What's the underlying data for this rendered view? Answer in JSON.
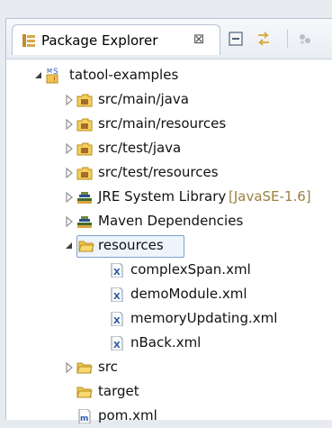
{
  "view": {
    "title": "Package Explorer",
    "close_glyph": "⊠",
    "toolbar_icons": [
      "collapse-all-icon",
      "link-with-editor-icon",
      "view-menu-icon"
    ]
  },
  "tree": {
    "project": {
      "label": "tatool-examples",
      "expanded": true,
      "icon": "maven-project-icon"
    },
    "items": [
      {
        "label": "src/main/java",
        "icon": "source-folder-icon",
        "expanded": false
      },
      {
        "label": "src/main/resources",
        "icon": "source-folder-icon",
        "expanded": false
      },
      {
        "label": "src/test/java",
        "icon": "source-folder-icon",
        "expanded": false
      },
      {
        "label": "src/test/resources",
        "icon": "source-folder-icon",
        "expanded": false
      },
      {
        "label": "JRE System Library",
        "decoration": "[JavaSE-1.6]",
        "icon": "library-icon",
        "expanded": false
      },
      {
        "label": "Maven Dependencies",
        "icon": "library-icon",
        "expanded": false
      },
      {
        "label": "resources",
        "icon": "folder-icon",
        "expanded": true,
        "selected": true
      },
      {
        "label": "complexSpan.xml",
        "icon": "xml-file-icon"
      },
      {
        "label": "demoModule.xml",
        "icon": "xml-file-icon"
      },
      {
        "label": "memoryUpdating.xml",
        "icon": "xml-file-icon"
      },
      {
        "label": "nBack.xml",
        "icon": "xml-file-icon"
      },
      {
        "label": "src",
        "icon": "folder-icon",
        "expanded": false
      },
      {
        "label": "target",
        "icon": "folder-icon"
      },
      {
        "label": "pom.xml",
        "icon": "maven-pom-icon"
      }
    ]
  },
  "colors": {
    "folder_yellow": "#f3cf5b",
    "selection_border": "#7da2ce",
    "decoration": "#9a7f40"
  }
}
